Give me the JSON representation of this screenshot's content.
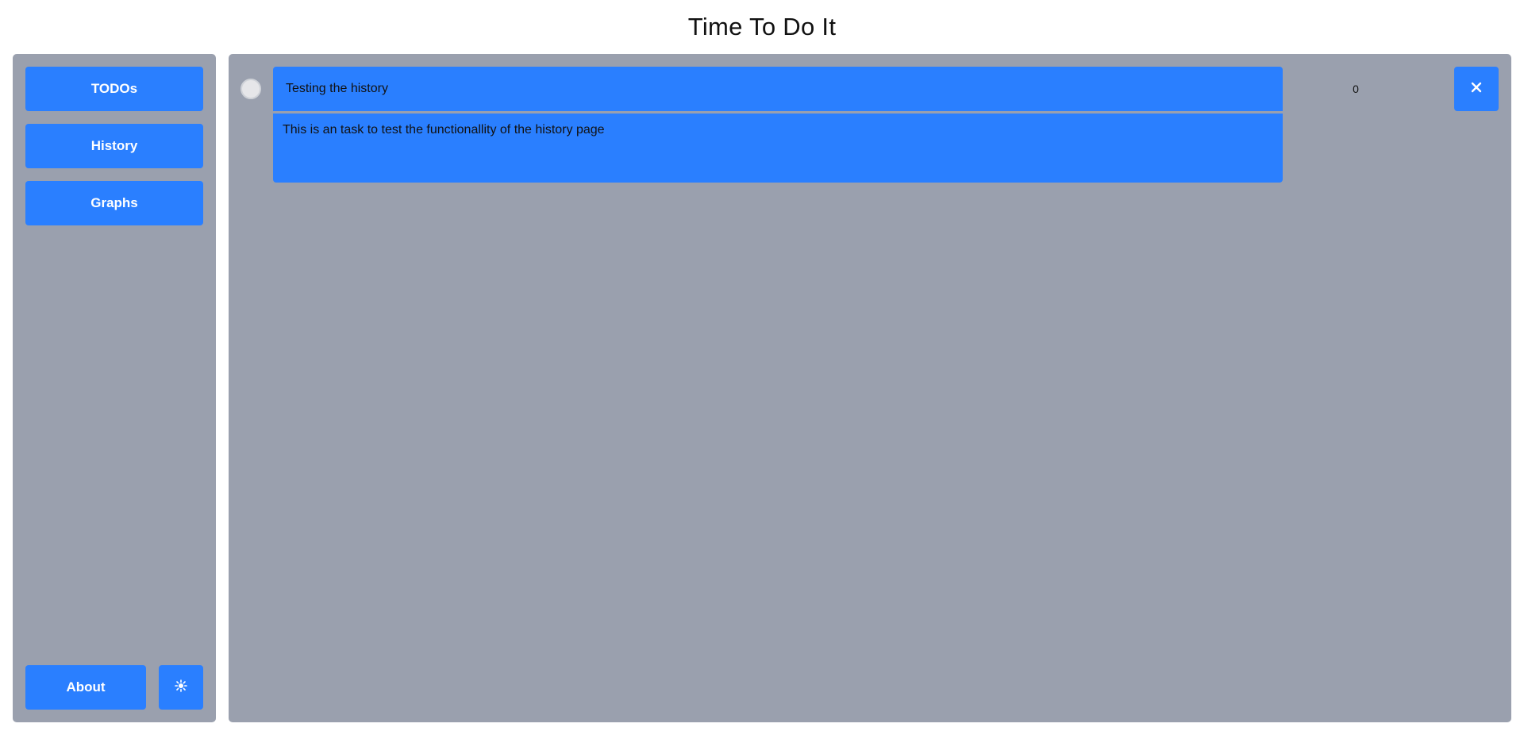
{
  "header": {
    "title": "Time To Do It"
  },
  "sidebar": {
    "items": [
      {
        "label": "TODOs"
      },
      {
        "label": "History"
      },
      {
        "label": "Graphs"
      }
    ],
    "about_label": "About",
    "theme_icon": "sun-icon"
  },
  "task": {
    "title": "Testing the history",
    "description": "This is an task to test the functionallity of the history page",
    "counter": "0",
    "delete_icon": "close-icon",
    "completed": false
  },
  "colors": {
    "accent": "#2a7fff",
    "panel": "#9aa0ae",
    "background": "#ffffff"
  }
}
